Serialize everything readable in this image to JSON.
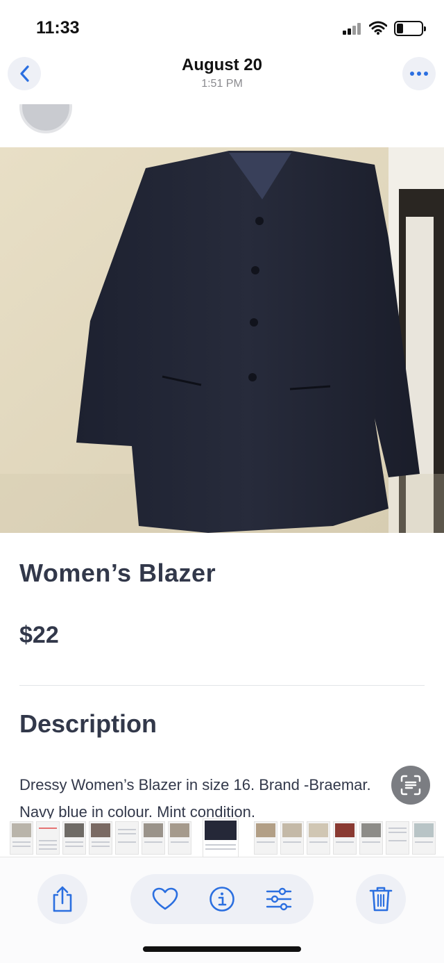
{
  "status_bar": {
    "time": "11:33",
    "icons": [
      "signal-icon",
      "wifi-icon",
      "battery-icon"
    ]
  },
  "nav": {
    "title": "August 20",
    "subtitle": "1:51 PM",
    "back_icon": "chevron-left-icon",
    "more_icon": "ellipsis-icon"
  },
  "listing": {
    "title": "Women’s  Blazer",
    "price": "$22",
    "description_heading": "Description",
    "description_lines": [
      "Dressy Women’s Blazer in size 16. Brand -Braemar.",
      "Navy blue in colour. Mint condition."
    ]
  },
  "toolbar": {
    "icons": [
      "share-icon",
      "heart-icon",
      "info-icon",
      "adjust-icon",
      "trash-icon"
    ]
  },
  "colors": {
    "accent": "#2b6fe0",
    "text": "#32384a",
    "button_bg": "#eef0f6"
  }
}
